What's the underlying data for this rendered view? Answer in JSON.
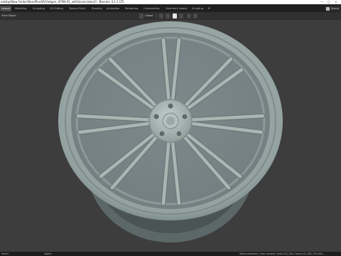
{
  "window": {
    "title": "esktop\\New Folder\\BendProd\\R\\Vietgen_VFMX-01_withScene.blend] - Blender 4.2.1 LTS",
    "controls": [
      "—",
      "□",
      "×"
    ]
  },
  "workspaces": {
    "tabs": [
      "Layout",
      "Modeling",
      "Sculpting",
      "UV Editing",
      "Texture Paint",
      "Shading",
      "Animation",
      "Rendering",
      "Compositing",
      "Geometry Nodes",
      "Scripting"
    ],
    "active": "Layout",
    "add_label": "+",
    "scene_label": "Scene"
  },
  "viewport_header": {
    "view_label": "View",
    "object_label": "Object",
    "orientation_label": "Global"
  },
  "status_bar": {
    "left": "Select",
    "mid": "Object",
    "right": "Status elements | Cam.Context | Verts:241,248 | Faces:241,248 | Tris:481,..."
  },
  "colors": {
    "viewport_bg": "#3d3d3d",
    "wheel_face": "#9eadab",
    "wheel_shadow": "#6f7c7b",
    "wheel_dark": "#55605f",
    "title_bg": "#ffffff",
    "menubar_bg": "#1f1f1f",
    "header_bg": "#303030"
  },
  "icons": [
    "blender-logo-icon",
    "editor-type-icon",
    "transform-orientation-icon",
    "pivot-icon",
    "snap-icon",
    "proportional-icon",
    "scene-icon"
  ]
}
